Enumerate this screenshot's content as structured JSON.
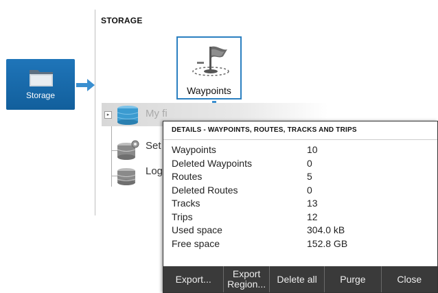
{
  "storage_tile": {
    "label": "Storage",
    "icon": "folder-icon"
  },
  "storage_panel": {
    "title": "STORAGE",
    "waypoints_tile": {
      "label": "Waypoints",
      "icon": "waypoint-flag-icon"
    },
    "tree": [
      {
        "label": "My fi",
        "icon": "database-icon",
        "selected": true
      },
      {
        "label": "Set",
        "icon": "database-settings-icon"
      },
      {
        "label": "Log",
        "icon": "database-icon"
      }
    ]
  },
  "details": {
    "title": "DETAILS - WAYPOINTS, ROUTES, TRACKS AND TRIPS",
    "rows": [
      {
        "label": "Waypoints",
        "value": "10"
      },
      {
        "label": "Deleted Waypoints",
        "value": "0"
      },
      {
        "label": "Routes",
        "value": "5"
      },
      {
        "label": "Deleted Routes",
        "value": "0"
      },
      {
        "label": "Tracks",
        "value": "13"
      },
      {
        "label": "Trips",
        "value": "12"
      },
      {
        "label": "Used space",
        "value": "304.0 kB"
      },
      {
        "label": "Free space",
        "value": "152.8 GB"
      }
    ],
    "buttons": {
      "export": "Export...",
      "export_region_1": "Export",
      "export_region_2": "Region...",
      "delete_all": "Delete all",
      "purge": "Purge",
      "close": "Close"
    }
  },
  "colors": {
    "accent": "#1f75b9",
    "button_bar": "#3a3a3a",
    "arrow": "#3a8fd0"
  }
}
